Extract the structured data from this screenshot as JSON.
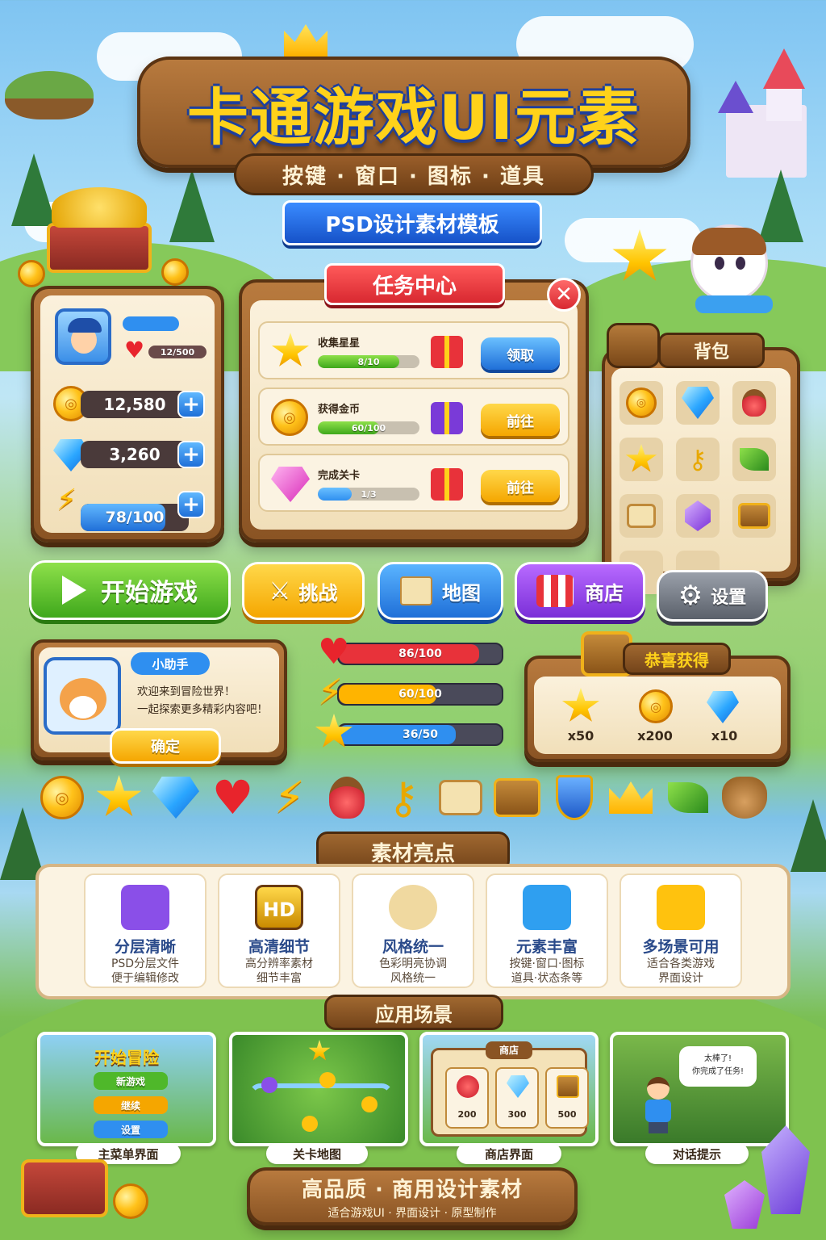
{
  "header": {
    "title": "卡通游戏UI元素",
    "subtitle": "按键 · 窗口 · 图标 · 道具",
    "ribbon": "PSD设计素材模板"
  },
  "profile": {
    "hearts": "12/500",
    "coins": "12,580",
    "gems": "3,260",
    "energy": "78/100"
  },
  "quest_panel": {
    "title": "任务中心",
    "items": [
      {
        "name": "收集星星",
        "progress": "8/10",
        "fraction": 0.8,
        "button": "领取"
      },
      {
        "name": "获得金币",
        "progress": "60/100",
        "fraction": 0.6,
        "button": "前往"
      },
      {
        "name": "完成关卡",
        "progress": "1/3",
        "fraction": 0.33,
        "button": "前往"
      }
    ]
  },
  "backpack": {
    "title": "背包",
    "slots": [
      "coin-icon",
      "gem-icon",
      "potion-icon",
      "star-icon",
      "key-icon",
      "leaf-icon",
      "scroll-icon",
      "purple-gem-icon",
      "chest-icon",
      "empty",
      "empty"
    ]
  },
  "main_buttons": {
    "start": "开始游戏",
    "challenge": "挑战",
    "map": "地图",
    "shop": "商店",
    "settings": "设置"
  },
  "dialog": {
    "speaker": "小助手",
    "line1": "欢迎来到冒险世界！",
    "line2": "一起探索更多精彩内容吧！",
    "confirm": "确定"
  },
  "status_bars": [
    {
      "label": "86/100",
      "fraction": 0.86,
      "color": "#e8323a"
    },
    {
      "label": "60/100",
      "fraction": 0.6,
      "color": "#ffb400"
    },
    {
      "label": "36/50",
      "fraction": 0.72,
      "color": "#2f8ff0"
    }
  ],
  "reward": {
    "title": "恭喜获得",
    "items": [
      "x50",
      "x200",
      "x10"
    ]
  },
  "icon_row": [
    "coin-icon",
    "star-icon",
    "gem-icon",
    "heart-icon",
    "bolt-icon",
    "potion-icon",
    "key-icon",
    "scroll-icon",
    "chest-icon",
    "shield-icon",
    "crown-icon",
    "leaf-icon",
    "coin-bag-icon"
  ],
  "features": {
    "title": "素材亮点",
    "items": [
      {
        "title": "分层清晰",
        "line1": "PSD分层文件",
        "line2": "便于编辑修改",
        "color": "#8a4fe8"
      },
      {
        "title": "高清细节",
        "line1": "高分辨率素材",
        "line2": "细节丰富",
        "color": "#c98a00"
      },
      {
        "title": "风格统一",
        "line1": "色彩明亮协调",
        "line2": "风格统一",
        "color": "#f0d9a0"
      },
      {
        "title": "元素丰富",
        "line1": "按键·窗口·图标",
        "line2": "道具·状态条等",
        "color": "#2f9ff0"
      },
      {
        "title": "多场景可用",
        "line1": "适合各类游戏",
        "line2": "界面设计",
        "color": "#ffc20e"
      }
    ]
  },
  "scenes": {
    "title": "应用场景",
    "menu": {
      "title": "开始冒险",
      "buttons": [
        "新游戏",
        "继续",
        "设置"
      ],
      "caption": "主菜单界面"
    },
    "map": {
      "caption": "关卡地图"
    },
    "shop": {
      "title": "商店",
      "prices": [
        "200",
        "300",
        "500"
      ],
      "caption": "商店界面"
    },
    "dialog": {
      "bubble1": "太棒了!",
      "bubble2": "你完成了任务!",
      "caption": "对话提示"
    }
  },
  "footer": {
    "title": "高品质 · 商用设计素材",
    "subtitle": "适合游戏UI · 界面设计 · 原型制作"
  }
}
